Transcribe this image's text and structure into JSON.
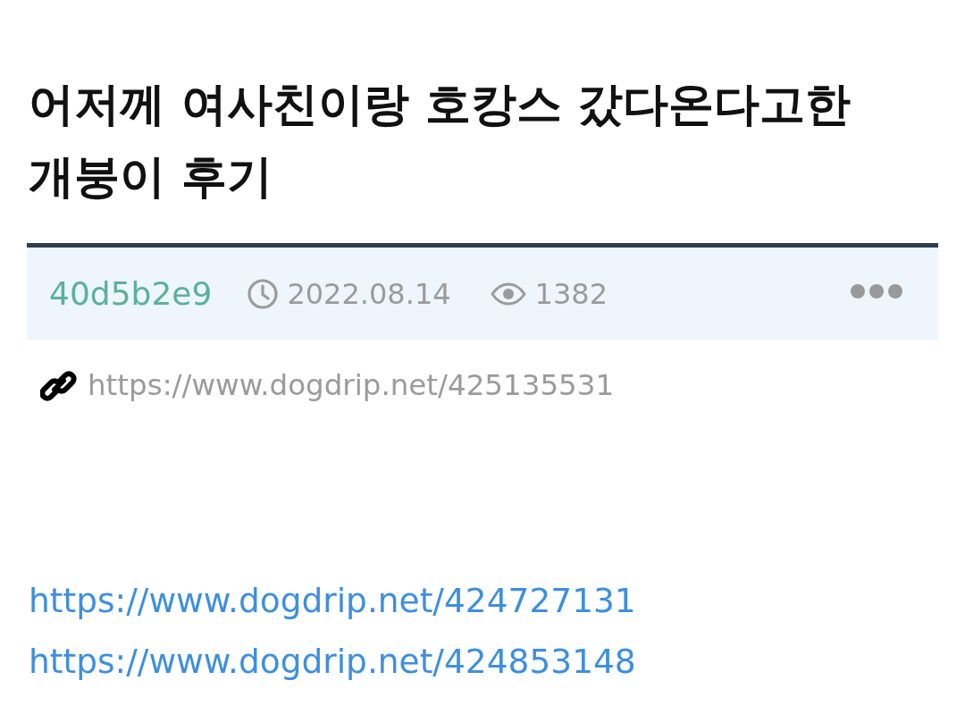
{
  "post": {
    "title": "어저께 여사친이랑 호캉스 갔다온다고한 개붕이 후기",
    "meta": {
      "author": "40d5b2e9",
      "date": "2022.08.14",
      "views": "1382"
    },
    "permalink": "https://www.dogdrip.net/425135531",
    "body_links": [
      "https://www.dogdrip.net/424727131",
      "https://www.dogdrip.net/424853148"
    ]
  }
}
